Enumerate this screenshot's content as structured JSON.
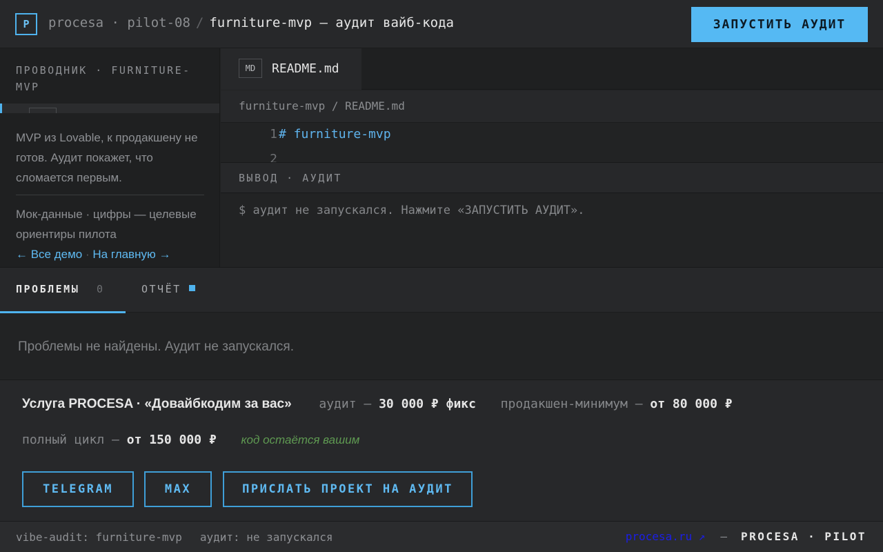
{
  "header": {
    "logo_letter": "P",
    "crumb_org": "procesa · pilot-08",
    "crumb_sep": "/",
    "crumb_current": "furniture-mvp — аудит вайб-кода",
    "run_button": "ЗАПУСТИТЬ АУДИТ"
  },
  "sidebar": {
    "title": "ПРОВОДНИК · FURNITURE-MVP",
    "description": "MVP из Lovable, к продакшену не готов. Аудит покажет, что сломается первым.",
    "note": "Мок-данные · цифры — целевые ориентиры пилота",
    "link_all": "← Все демо",
    "link_sep": "·",
    "link_home": "На главную →"
  },
  "editor": {
    "tab_badge": "MD",
    "tab_name": "README.md",
    "path": "furniture-mvp / README.md",
    "lines": [
      {
        "num": "1",
        "text": "# furniture-mvp"
      },
      {
        "num": "2",
        "text": ""
      }
    ]
  },
  "output": {
    "title": "ВЫВОД · АУДИТ",
    "text": "$ аудит не запускался. Нажмите «ЗАПУСТИТЬ АУДИТ»."
  },
  "problems": {
    "tab_label": "ПРОБЛЕМЫ",
    "count": "0",
    "report_label": "ОТЧЁТ",
    "empty_text": "Проблемы не найдены. Аудит не запускался."
  },
  "service": {
    "title": "Услуга PROCESA · «Довайбкодим за вас»",
    "audit_label": "аудит —",
    "audit_price": "30 000 ₽ фикс",
    "prod_label": "продакшен-минимум —",
    "prod_price": "от 80 000 ₽",
    "full_label": "полный цикл —",
    "full_price": "от 150 000 ₽",
    "code_note": "код остаётся вашим",
    "btn_telegram": "TELEGRAM",
    "btn_max": "MAX",
    "btn_send": "ПРИСЛАТЬ ПРОЕКТ НА АУДИТ"
  },
  "status": {
    "left1": "vibe-audit: furniture-mvp",
    "left2": "аудит: не запускался",
    "link": "procesa.ru ↗",
    "dash": "—",
    "brand": "PROCESA · PILOT"
  },
  "colors": {
    "accent": "#55b9f3",
    "background": "#222324",
    "panel": "#27282a",
    "green_note": "#5f9a52"
  }
}
